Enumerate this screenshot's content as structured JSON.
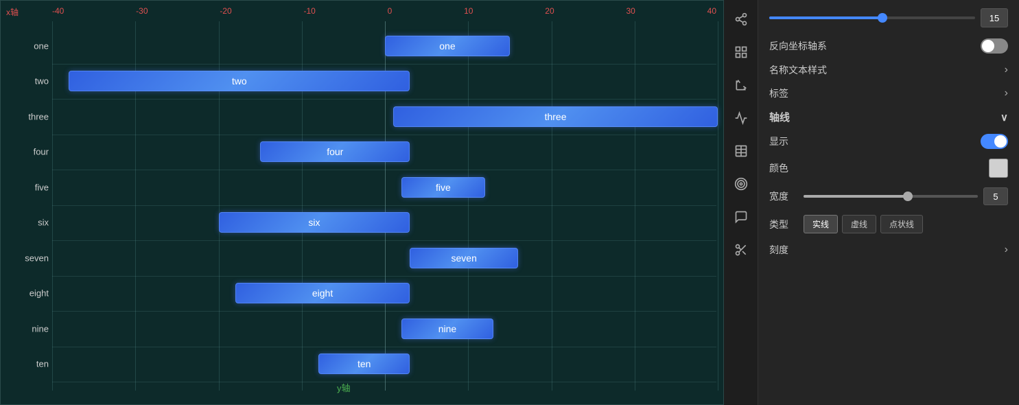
{
  "chart": {
    "xAxisTitle": "x轴",
    "yAxisTitle": "y轴",
    "xLabels": [
      "-40",
      "-30",
      "-20",
      "-10",
      "0",
      "10",
      "20",
      "30",
      "40"
    ],
    "bars": [
      {
        "name": "one",
        "start": 0,
        "end": 15,
        "label": "one"
      },
      {
        "name": "two",
        "start": -38,
        "end": 3,
        "label": "two"
      },
      {
        "name": "three",
        "start": 1,
        "end": 40,
        "label": "three"
      },
      {
        "name": "four",
        "start": -15,
        "end": 3,
        "label": "four"
      },
      {
        "name": "five",
        "start": 2,
        "end": 12,
        "label": "five"
      },
      {
        "name": "six",
        "start": -20,
        "end": 3,
        "label": "six"
      },
      {
        "name": "seven",
        "start": 3,
        "end": 16,
        "label": "seven"
      },
      {
        "name": "eight",
        "start": -18,
        "end": 3,
        "label": "eight"
      },
      {
        "name": "nine",
        "start": 2,
        "end": 13,
        "label": "nine"
      },
      {
        "name": "ten",
        "start": -8,
        "end": 3,
        "label": "ten"
      }
    ]
  },
  "panel": {
    "sliderValue": "15",
    "reverseAxisLabel": "反向坐标轴系",
    "nameStyleLabel": "名称文本样式",
    "tagLabel": "标签",
    "axisLabel": "轴线",
    "showLabel": "显示",
    "colorLabel": "颜色",
    "widthLabel": "宽度",
    "widthValue": "5",
    "typeLabel": "类型",
    "typeButtons": [
      "实线",
      "虚线",
      "点状线"
    ],
    "scaleLabel": "刻度",
    "activeType": "实线"
  }
}
